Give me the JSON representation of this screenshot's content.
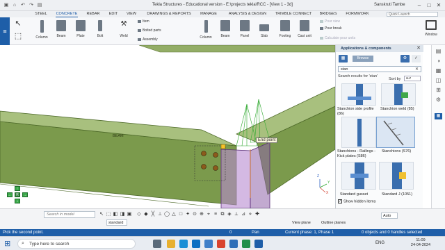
{
  "titlebar": {
    "title": "Tekla Structures - Educational version - E:\\projects tekla\\RCC - [View 1 - 3d]",
    "user": "Sanskruti Tambe",
    "minimize": "–",
    "maximize": "□",
    "close": "✕"
  },
  "menus": [
    "STEEL",
    "CONCRETE",
    "REBAR",
    "EDIT",
    "VIEW",
    "DRAWINGS & REPORTS",
    "MANAGE",
    "ANALYSIS & DESIGN",
    "TRIMBLE CONNECT",
    "BRIDGES",
    "FORMWORK"
  ],
  "active_menu": "CONCRETE",
  "quick_launch": "Quick Launch",
  "ribbon": {
    "steel_tools": [
      "Column",
      "Beam",
      "Plate",
      "Bolt",
      "Weld"
    ],
    "item_group": [
      "Item",
      "Bolted parts",
      "Assembly"
    ],
    "concrete_tools": [
      "Column",
      "Beam",
      "Panel",
      "Slab",
      "Footing"
    ],
    "cast_unit": "Cast unit",
    "pour_group": [
      "Pour view",
      "Pour break",
      "Calculate pour units"
    ],
    "window": "Window"
  },
  "viewport": {
    "beam_label": "BEAM",
    "snap_tooltip": "End point",
    "axis_z": "Z",
    "axis_y": "Y",
    "axis_x": "X"
  },
  "panel": {
    "title": "Applications & components",
    "button": "Browse selected",
    "search": "stan",
    "results": "Search results for 'stan'",
    "sort_label": "Sort by",
    "sort_value": "a-z",
    "items": [
      {
        "caption": "Stanchion side profile (86)"
      },
      {
        "caption": "Stanchion weld (85)"
      },
      {
        "caption": "Stanchions - Railings - Kick plates (S86)"
      },
      {
        "caption": "Stanchions (S76)"
      },
      {
        "caption": "Standard gusset"
      },
      {
        "caption": "Standard J (1051)"
      }
    ],
    "show_hidden": "Show hidden items"
  },
  "bottombar": {
    "search_placeholder": "Search in model",
    "standard": "standard",
    "auto": "Auto",
    "view_plane": "View plane",
    "outline_plane": "Outline planes"
  },
  "statusbar": {
    "prompt": "Pick the second point.",
    "coords": "0",
    "pan": "Pan",
    "phase": "Current phase: 1, Phase 1",
    "selection": "0 objects and 0 handles selected"
  },
  "taskbar": {
    "search": "Type here to search",
    "lang": "ENG",
    "time": "11:09",
    "date": "24-04-2024"
  },
  "colors": {
    "accent": "#1e5ea8",
    "beam": "#7b9a4c",
    "snap_green": "#2fa82f"
  }
}
